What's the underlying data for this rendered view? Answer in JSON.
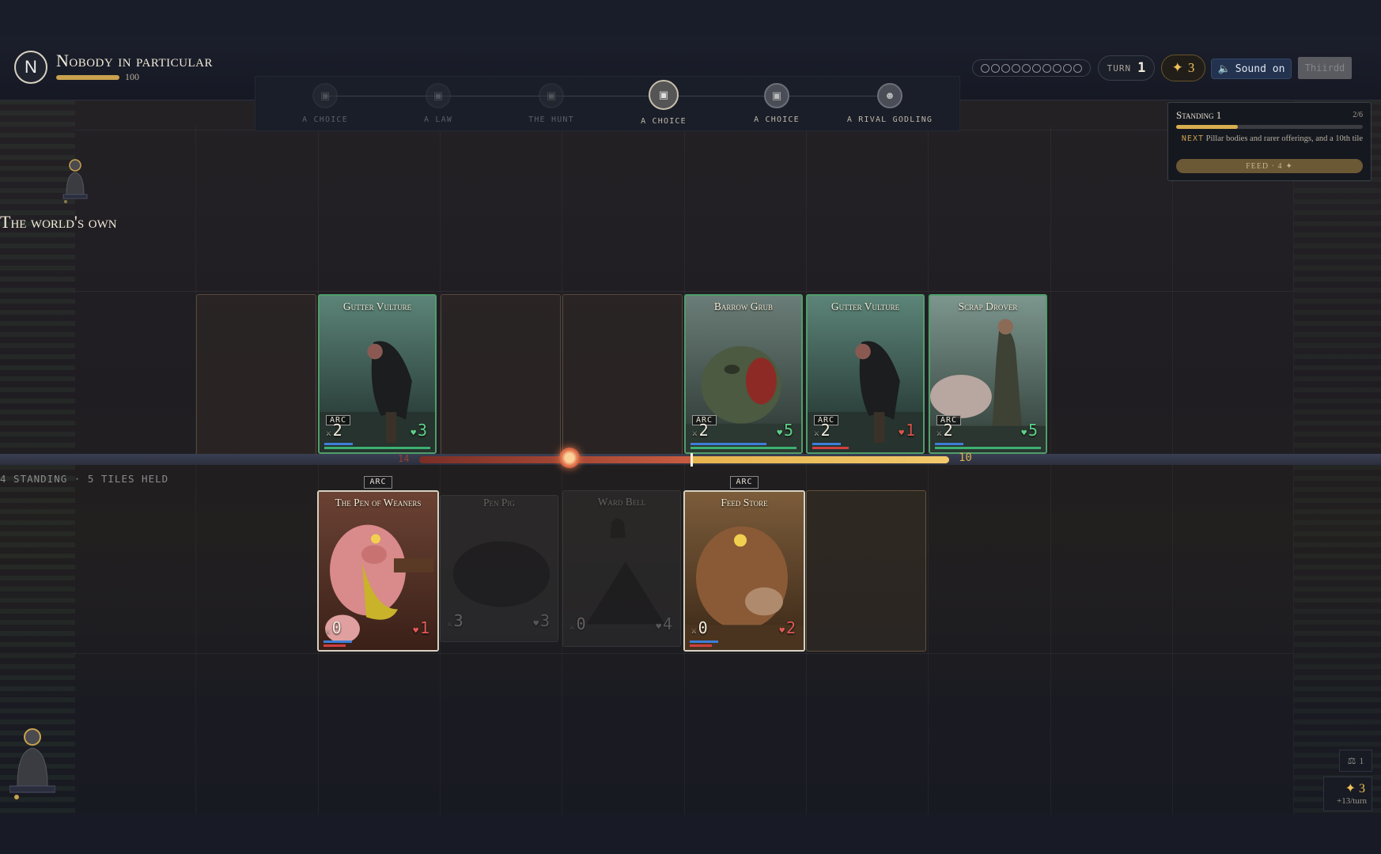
{
  "header": {
    "avatar_letter": "N",
    "player_name": "Nobody in particular",
    "player_hp": "100",
    "timeline": [
      {
        "label": "A CHOICE",
        "state": "past"
      },
      {
        "label": "A LAW",
        "state": "past"
      },
      {
        "label": "THE HUNT",
        "state": "past"
      },
      {
        "label": "A CHOICE",
        "state": "current"
      },
      {
        "label": "A CHOICE",
        "state": "upcoming"
      },
      {
        "label": "A RIVAL GODLING",
        "state": "upcoming"
      }
    ],
    "turn_label": "TURN",
    "turn_value": "1",
    "favor_value": "3",
    "sound_label": "Sound on",
    "end_button_label": "Thiirdd"
  },
  "standing": {
    "title": "Standing 1",
    "count": "2/6",
    "progress": 0.33,
    "next_key": "NEXT",
    "next_text": "Pillar bodies and rarer offerings, and a 10th tile",
    "feed_label": "FEED · 4"
  },
  "opponent": {
    "name": "The world's own"
  },
  "enemy_cards": [
    {
      "title": "Gutter Vulture",
      "tag": "ARC",
      "atk": "2",
      "hp": "3",
      "hp_color": "#5fd187"
    },
    {
      "title": "Barrow Grub",
      "tag": "ARC",
      "atk": "2",
      "hp": "5",
      "hp_color": "#5fd187"
    },
    {
      "title": "Gutter Vulture",
      "tag": "ARC",
      "atk": "2",
      "hp": "1",
      "hp_color": "#d8554c"
    },
    {
      "title": "Scrap Drover",
      "tag": "ARC",
      "atk": "2",
      "hp": "5",
      "hp_color": "#5fd187"
    }
  ],
  "track": {
    "left_value": "14",
    "right_value": "10"
  },
  "held_label": "4 STANDING · 5 TILES HELD",
  "my_cards": [
    {
      "title": "The Pen of Weaners",
      "tag": "ARC",
      "atk": "0",
      "hp": "1",
      "hp_color": "#e25a58"
    },
    {
      "title": "Pen Pig",
      "atk": "3",
      "hp": "3"
    },
    {
      "title": "Ward Bell",
      "atk": "0",
      "hp": "4"
    },
    {
      "title": "Feed Store",
      "tag": "ARC",
      "atk": "0",
      "hp": "2",
      "hp_color": "#e25a58"
    }
  ],
  "footer": {
    "scale_count": "1",
    "income_total": "3",
    "income_rate": "+13/turn"
  },
  "colors": {
    "accent_gold": "#d9ae4e",
    "enemy_border": "#4f9e6a",
    "track_red": "#c85c40"
  }
}
